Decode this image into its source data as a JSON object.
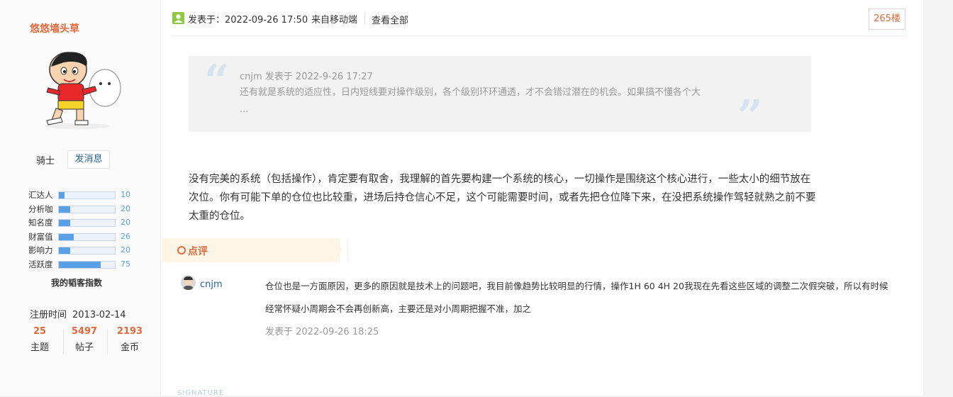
{
  "sidebar": {
    "username": "悠悠墙头草",
    "rank": "骑士",
    "message_button": "发消息",
    "stats": [
      {
        "label": "汇达人",
        "value": "10",
        "level": 0.1
      },
      {
        "label": "分析咖",
        "value": "20",
        "level": 0.2
      },
      {
        "label": "知名度",
        "value": "20",
        "level": 0.2
      },
      {
        "label": "财富值",
        "value": "26",
        "level": 0.26
      },
      {
        "label": "影响力",
        "value": "20",
        "level": 0.2
      },
      {
        "label": "活跃度",
        "value": "75",
        "level": 0.75
      }
    ],
    "stats_caption": "我的韬客指数",
    "register_label": "注册时间",
    "register_date": "2013-02-14",
    "counts": [
      {
        "num": "25",
        "label": "主题"
      },
      {
        "num": "5497",
        "label": "帖子"
      },
      {
        "num": "2193",
        "label": "金币"
      }
    ]
  },
  "header": {
    "posted": "发表于：2022-09-26 17:50",
    "source": "来自移动端",
    "view_all": "查看全部",
    "floor": "265楼"
  },
  "quote": {
    "header": "cnjm 发表于 2022-9-26 17:27",
    "body": "还有就是系统的适应性，日内短线要对操作级别，各个级别环环通透，才不会错过潜在的机会。如果搞不懂各个大 ..."
  },
  "content": "没有完美的系统（包括操作），肯定要有取舍，我理解的首先要构建一个系统的核心，一切操作是围绕这个核心进行，一些太小的细节放在次位。你有可能下单的仓位也比较重，进场后持仓信心不足，这个可能需要时间，或者先把仓位降下来，在没把系统操作驾轻就熟之前不要太重的仓位。",
  "comments": {
    "section_label": "点评",
    "items": [
      {
        "user": "cnjm",
        "text": "仓位也是一方面原因，更多的原因就是技术上的问题吧，我目前像趋势比较明显的行情，操作1H 60 4H 20我现在先看这些区域的调整二次假突破，所以有时候经常怀疑小周期会不会再创新高，主要还是对小周期把握不准，加之",
        "time": "发表于 2022-09-26 18:25"
      }
    ]
  },
  "signature_label": "SIGNATURE",
  "colors": {
    "accent": "#e06a3b",
    "link": "#2a6496",
    "bar": "#5aa0e6",
    "user_icon": "#8fc742"
  }
}
